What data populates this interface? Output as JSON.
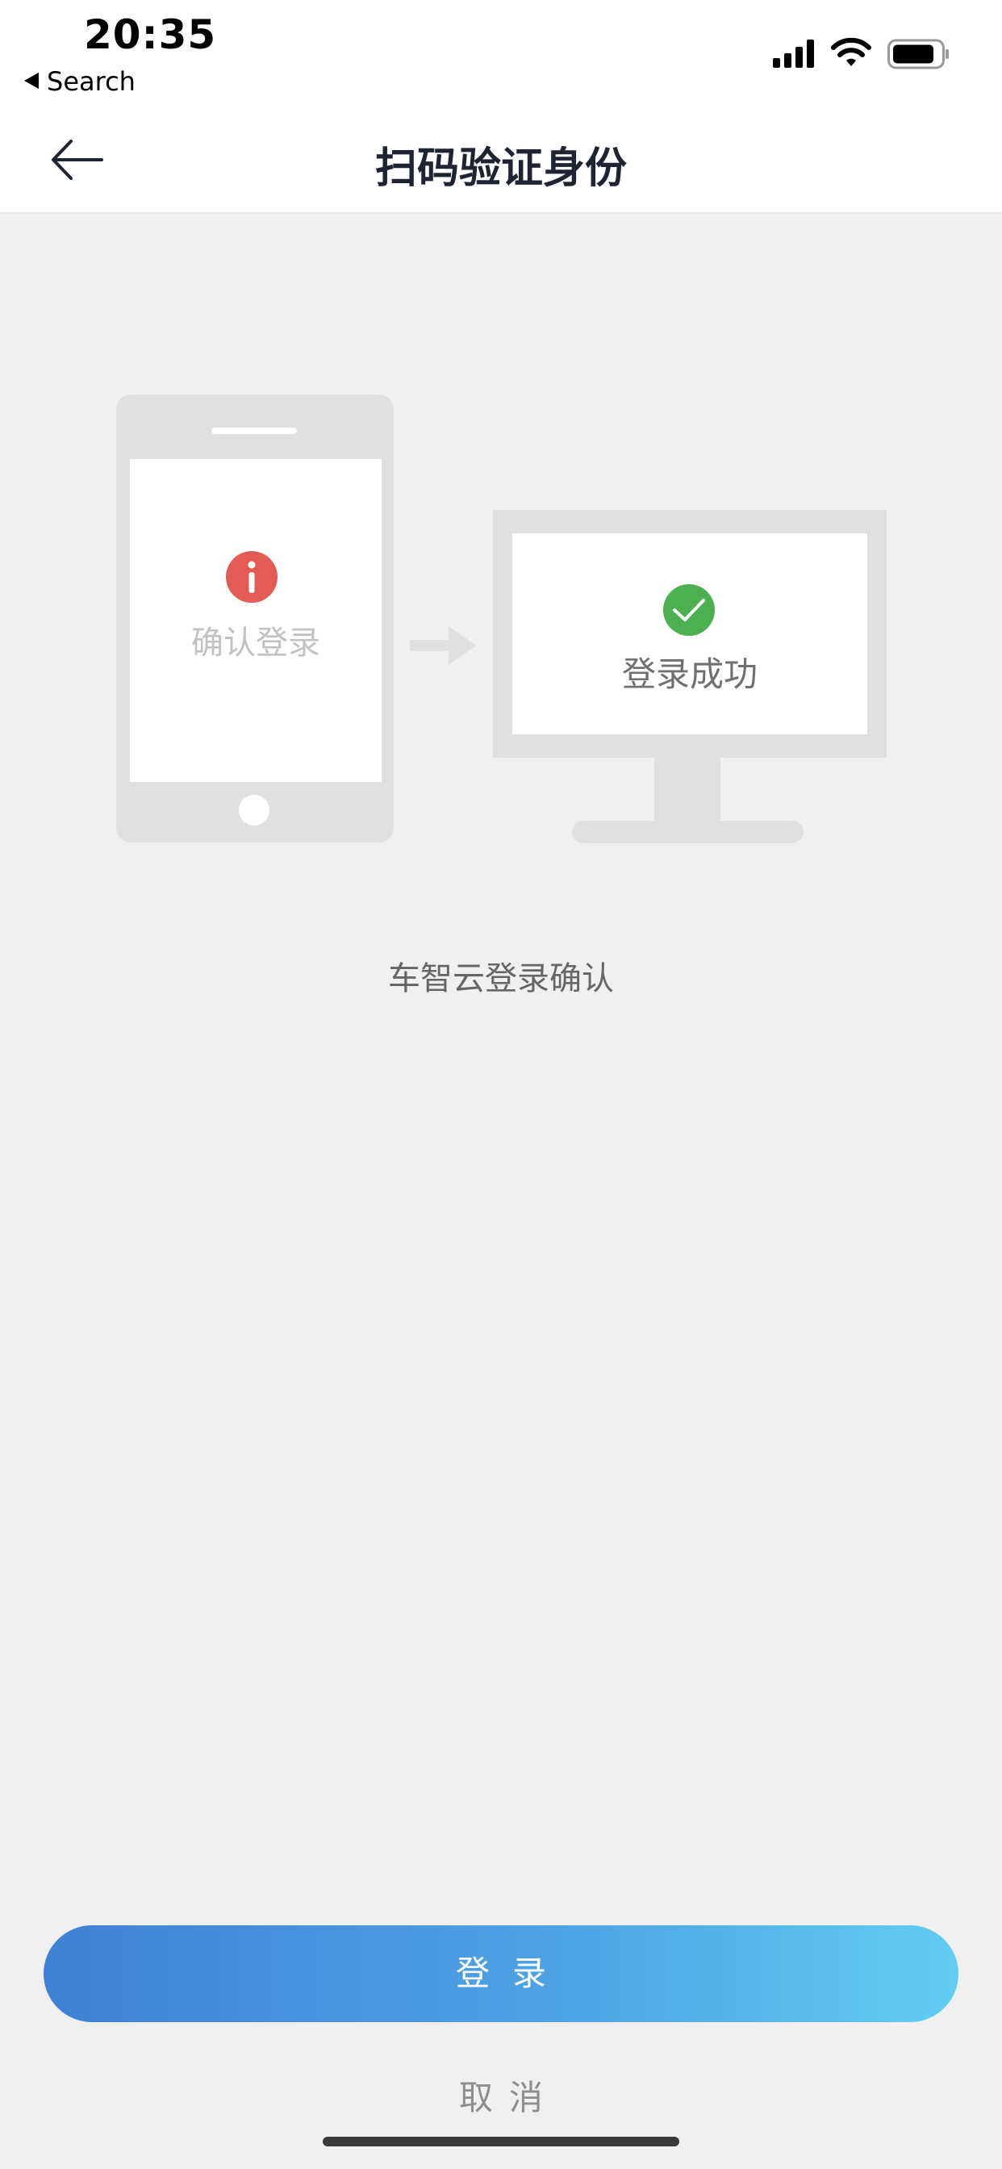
{
  "status_bar": {
    "time": "20:35",
    "back_app_label": "Search",
    "icons": [
      "cellular-signal-icon",
      "wifi-icon",
      "battery-icon"
    ]
  },
  "nav": {
    "title": "扫码验证身份",
    "back_icon": "arrow-left-icon"
  },
  "illustration": {
    "phone_label": "确认登录",
    "phone_icon": "info-icon",
    "monitor_label": "登录成功",
    "monitor_icon": "check-circle-icon",
    "arrow_icon": "arrow-right-icon"
  },
  "caption": "车智云登录确认",
  "actions": {
    "login_label": "登录",
    "cancel_label": "取消"
  },
  "colors": {
    "background": "#f0f0f1",
    "title": "#1f2433",
    "info_red": "#e45a55",
    "success_green": "#4caf50",
    "button_gradient_start": "#3f81d6",
    "button_gradient_end": "#62cdf3"
  }
}
